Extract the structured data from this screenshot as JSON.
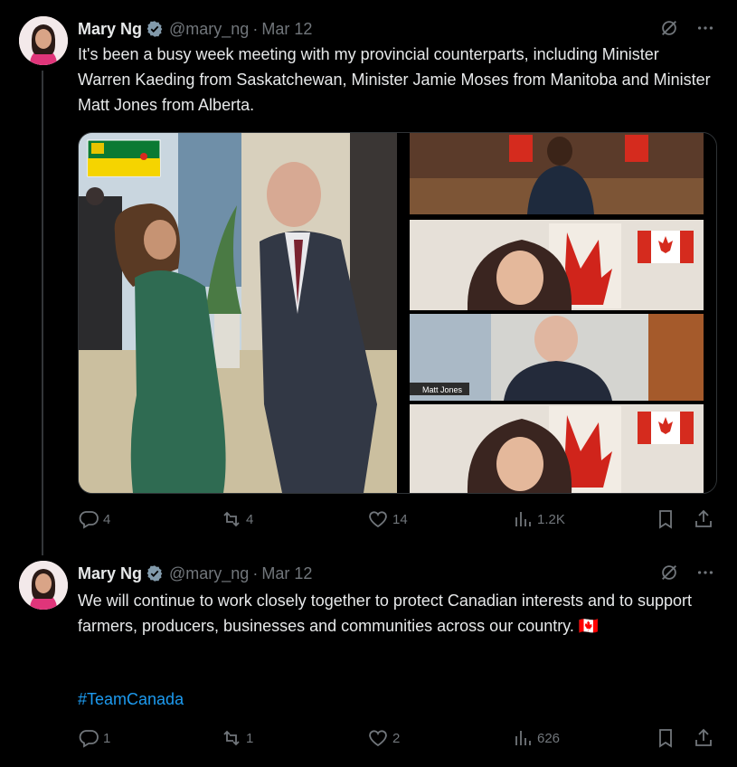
{
  "tweets": [
    {
      "author_name": "Mary Ng",
      "handle": "@mary_ng",
      "separator": "·",
      "date": "Mar 12",
      "text": "It's been a busy week meeting with my provincial counterparts, including Minister Warren Kaeding from Saskatchewan, Minister Jamie Moses from Manitoba and Minister Matt Jones from Alberta.",
      "media": {
        "video_label": "Matt Jones"
      },
      "replies": "4",
      "reposts": "4",
      "likes": "14",
      "views": "1.2K"
    },
    {
      "author_name": "Mary Ng",
      "handle": "@mary_ng",
      "separator": "·",
      "date": "Mar 12",
      "text": "We will continue to work closely together to protect Canadian interests and to support farmers, producers, businesses and communities across our country. 🇨🇦",
      "hashtag": "#TeamCanada",
      "replies": "1",
      "reposts": "1",
      "likes": "2",
      "views": "626"
    }
  ],
  "icons": [
    "verified-badge-icon",
    "grok-icon",
    "more-icon",
    "reply-icon",
    "repost-icon",
    "like-icon",
    "views-icon",
    "bookmark-icon",
    "share-icon"
  ],
  "colors": {
    "background": "#000000",
    "text": "#e7e9ea",
    "muted": "#71767b",
    "accent": "#1d9bf0"
  }
}
